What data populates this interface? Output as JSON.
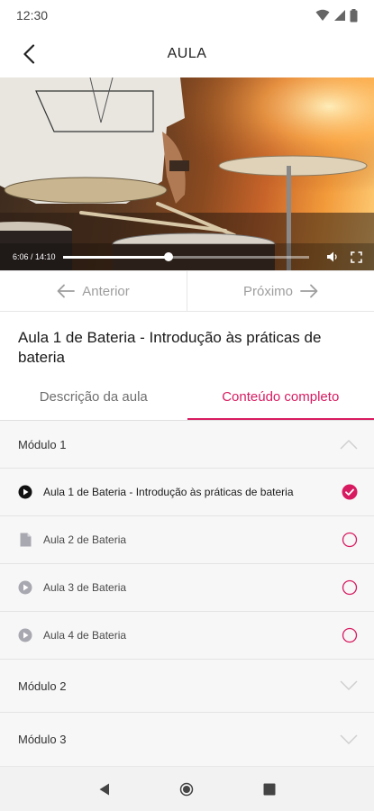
{
  "status_bar": {
    "time": "12:30"
  },
  "app_bar": {
    "title": "AULA"
  },
  "video": {
    "time_label": "6:06 / 14:10",
    "progress": 0.43
  },
  "navigation": {
    "prev_label": "Anterior",
    "next_label": "Próximo"
  },
  "lesson": {
    "title": "Aula 1 de Bateria - Introdução às práticas de bateria"
  },
  "tabs": [
    {
      "label": "Descrição da aula",
      "active": false
    },
    {
      "label": "Conteúdo completo",
      "active": true
    }
  ],
  "content": {
    "modules": [
      {
        "label": "Módulo 1",
        "expanded": true
      },
      {
        "label": "Módulo 2",
        "expanded": false
      },
      {
        "label": "Módulo 3",
        "expanded": false
      }
    ],
    "lessons": [
      {
        "label": "Aula 1 de Bateria - Introdução às práticas de bateria",
        "icon": "play-filled-icon",
        "completed": true
      },
      {
        "label": "Aula 2 de Bateria",
        "icon": "document-icon",
        "completed": false
      },
      {
        "label": "Aula 3 de Bateria",
        "icon": "play-circle-icon",
        "completed": false
      },
      {
        "label": "Aula 4 de Bateria",
        "icon": "play-circle-icon",
        "completed": false
      }
    ]
  },
  "colors": {
    "accent": "#d81b60",
    "muted": "#9e9e9e"
  }
}
